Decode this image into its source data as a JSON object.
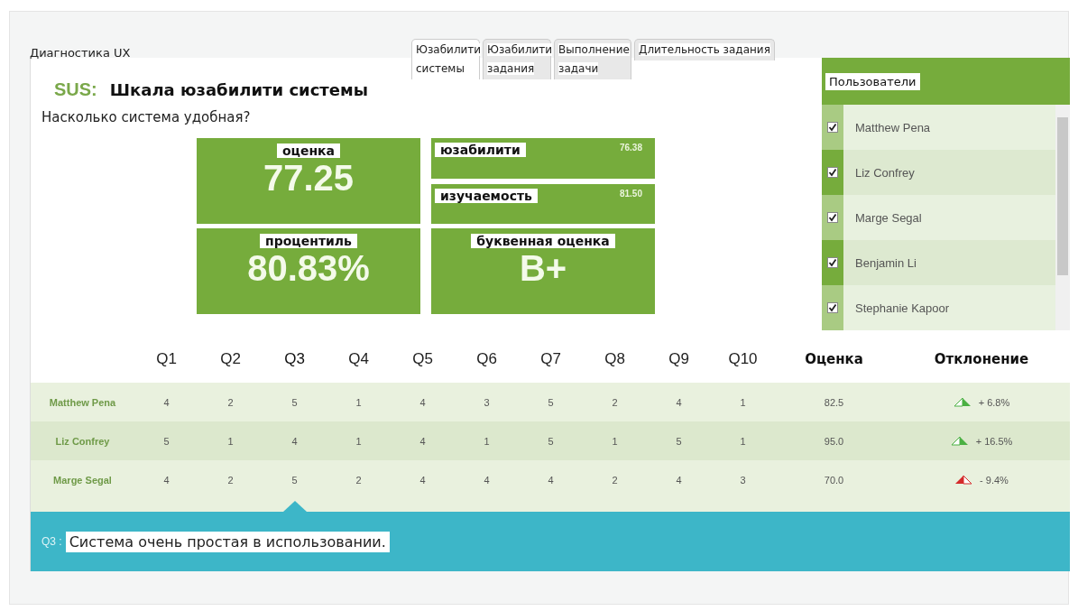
{
  "app_title": "Диагностика UX",
  "tabs": [
    {
      "label": "Юзабилити системы",
      "selected": true
    },
    {
      "label": "Юзабилити задания",
      "selected": false
    },
    {
      "label": "Выполнение задачи",
      "selected": false
    },
    {
      "label": "Длительность задания",
      "selected": false
    }
  ],
  "heading": {
    "prefix": "SUS:",
    "title": "Шкала юзабилити системы"
  },
  "subtitle": "Насколько система удобная?",
  "tiles": {
    "score": {
      "label": "оценка",
      "value": "77.25"
    },
    "usability": {
      "label": "юзабилити",
      "value": "76.38"
    },
    "learnability": {
      "label": "изучаемость",
      "value": "81.50"
    },
    "percentile": {
      "label": "процентиль",
      "value": "80.83%"
    },
    "grade": {
      "label": "буквенная оценка",
      "value": "B+"
    }
  },
  "users_panel": {
    "title": "Пользователи",
    "users": [
      {
        "name": "Matthew Pena",
        "checked": true
      },
      {
        "name": "Liz Confrey",
        "checked": true
      },
      {
        "name": "Marge Segal",
        "checked": true
      },
      {
        "name": "Benjamin Li",
        "checked": true
      },
      {
        "name": "Stephanie Kapoor",
        "checked": true
      }
    ]
  },
  "table": {
    "question_columns": [
      {
        "label": "Q1",
        "selected": false
      },
      {
        "label": "Q2",
        "selected": false
      },
      {
        "label": "Q3",
        "selected": true
      },
      {
        "label": "Q4",
        "selected": false
      },
      {
        "label": "Q5",
        "selected": false
      },
      {
        "label": "Q6",
        "selected": false
      },
      {
        "label": "Q7",
        "selected": false
      },
      {
        "label": "Q8",
        "selected": false
      },
      {
        "label": "Q9",
        "selected": false
      },
      {
        "label": "Q10",
        "selected": false
      }
    ],
    "score_column": "Оценка",
    "deviation_column": "Отклонение",
    "rows": [
      {
        "name": "Matthew Pena",
        "answers": [
          "4",
          "2",
          "5",
          "1",
          "4",
          "3",
          "5",
          "2",
          "4",
          "1"
        ],
        "score": "82.5",
        "kind": "up",
        "deviation": "+ 6.8%"
      },
      {
        "name": "Liz Confrey",
        "answers": [
          "5",
          "1",
          "4",
          "1",
          "4",
          "1",
          "5",
          "1",
          "5",
          "1"
        ],
        "score": "95.0",
        "kind": "up",
        "deviation": "+ 16.5%"
      },
      {
        "name": "Marge Segal",
        "answers": [
          "4",
          "2",
          "5",
          "2",
          "4",
          "4",
          "4",
          "2",
          "4",
          "3"
        ],
        "score": "70.0",
        "kind": "down",
        "deviation": "- 9.4%"
      }
    ]
  },
  "question_bar": {
    "label": "Q3 :",
    "text": "Система очень простая в использовании."
  }
}
